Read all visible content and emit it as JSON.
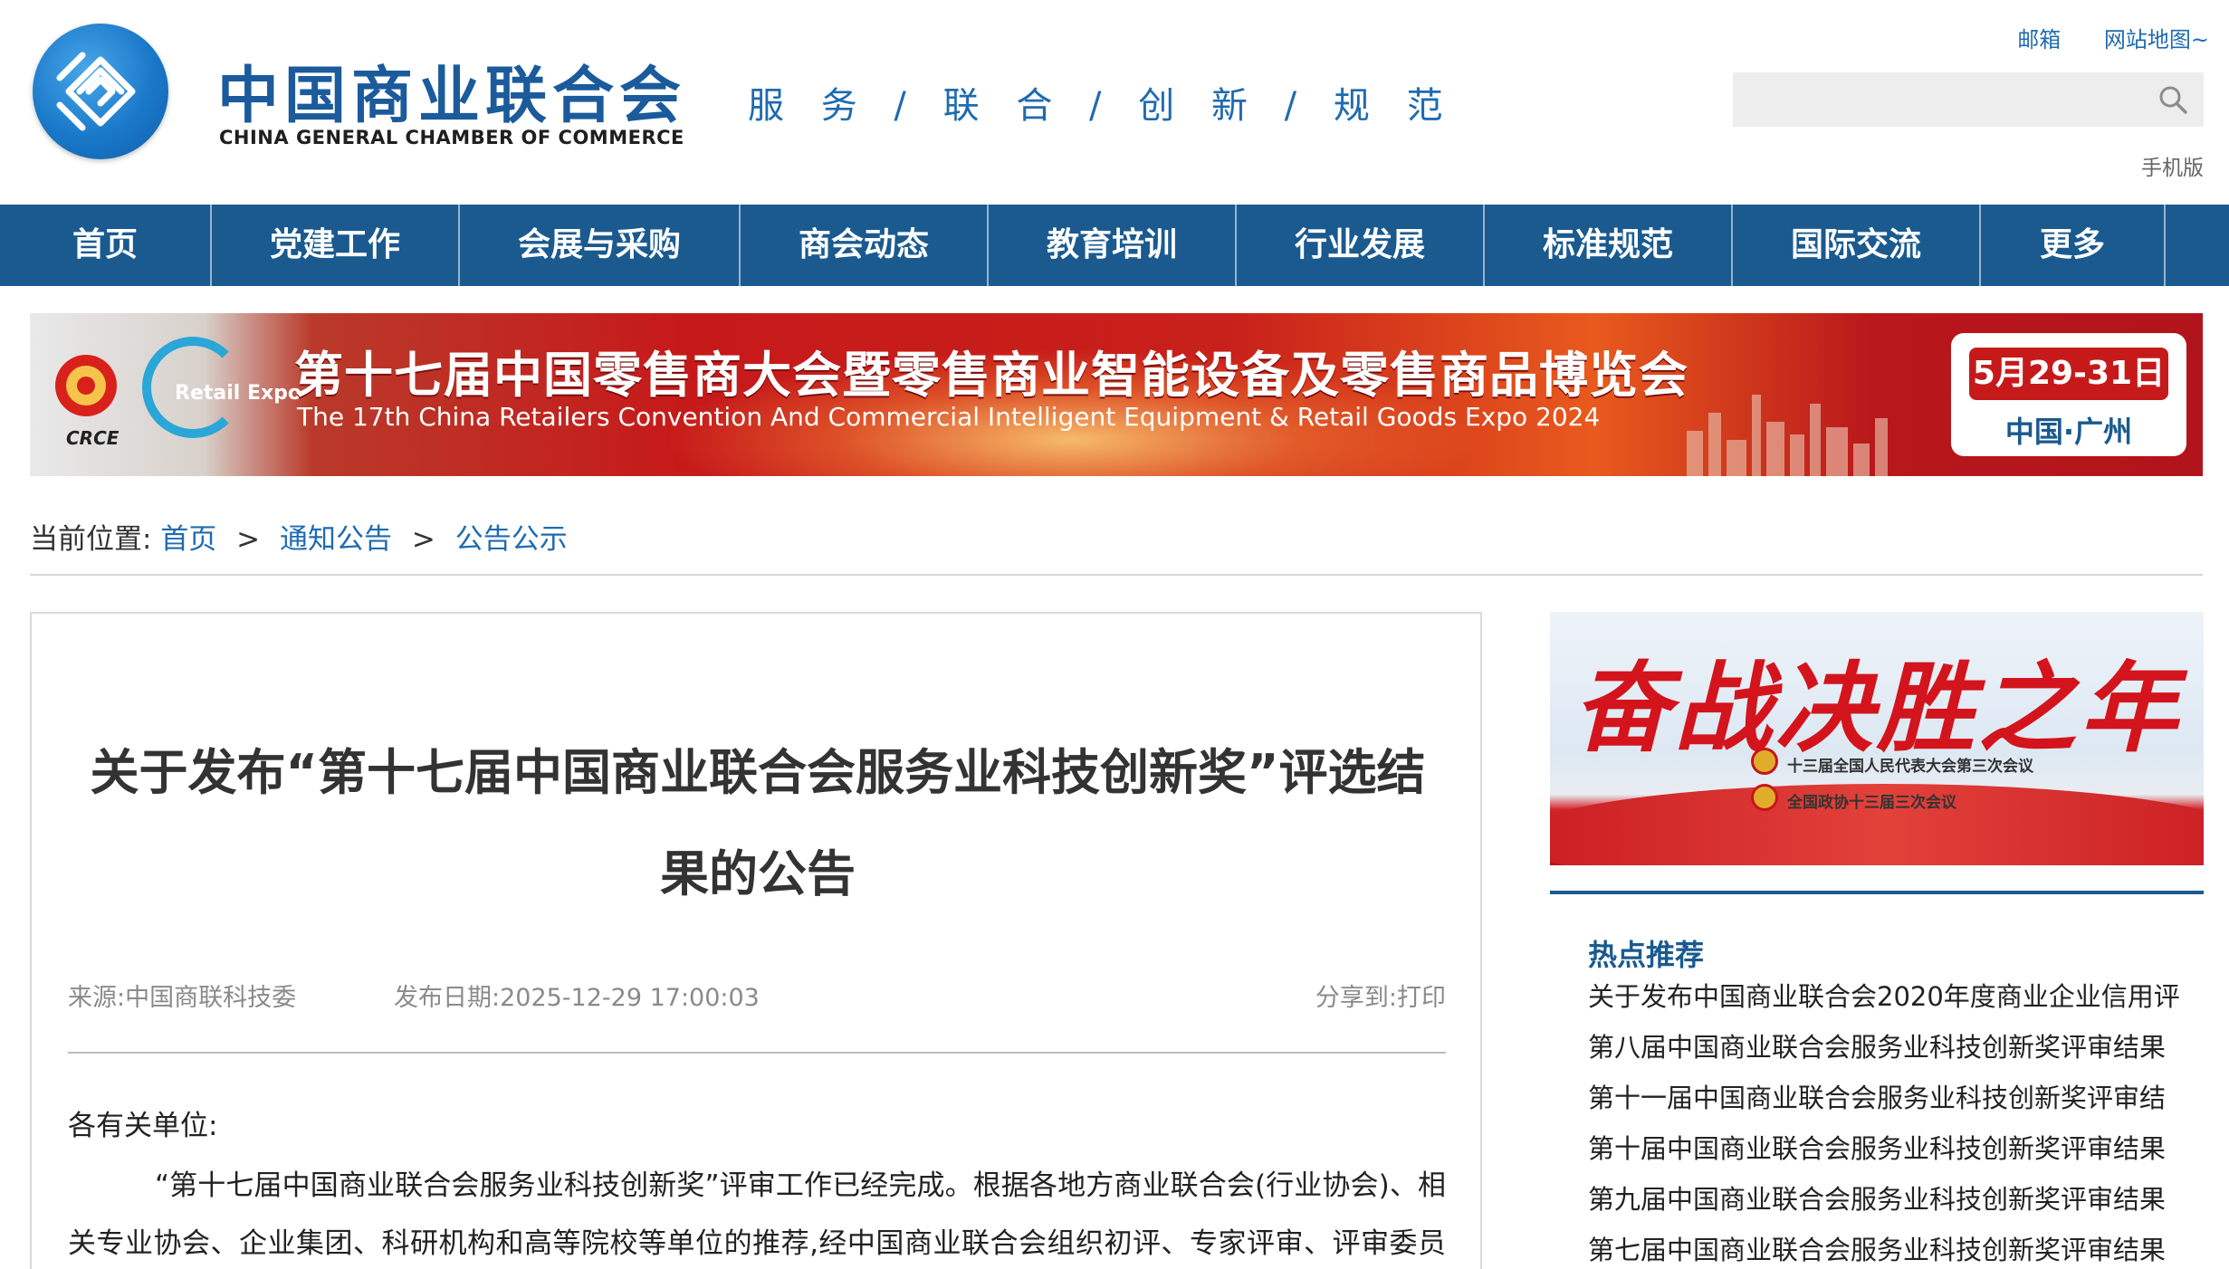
{
  "header": {
    "org_name_cn": "中国商业联合会",
    "org_name_en": "CHINA GENERAL CHAMBER OF COMMERCE",
    "slogan": "服 务 / 联 合 / 创 新 / 规 范",
    "top_links": [
      "邮箱",
      "网站地图~"
    ],
    "search": {
      "placeholder": ""
    },
    "mobile_link": "手机版"
  },
  "nav": {
    "items": [
      "首页",
      "党建工作",
      "会展与采购",
      "商会动态",
      "教育培训",
      "行业发展",
      "标准规范",
      "国际交流",
      "更多"
    ]
  },
  "banner": {
    "crce_label": "CRCE",
    "retail_expo": "Retail Expo",
    "title": "第十七届中国零售商大会暨零售商业智能设备及零售商品博览会",
    "subtitle": "The 17th China Retailers Convention And Commercial Intelligent Equipment & Retail Goods Expo 2024",
    "date": "5月29-31日",
    "place": "中国·广州"
  },
  "breadcrumb": {
    "prefix": "当前位置:",
    "items": [
      "首页",
      "通知公告",
      "公告公示"
    ],
    "separator": ">"
  },
  "article": {
    "title": "关于发布“第十七届中国商业联合会服务业科技创新奖”评选结果的公告",
    "source": "来源:中国商联科技委",
    "date": "发布日期:2025-12-29 17:00:03",
    "share_label": "分享到:",
    "print_label": "打印",
    "salutation": "各有关单位:",
    "body": "“第十七届中国商业联合会服务业科技创新奖”评审工作已经完成。根据各地方商业联合会(行业协会)、相关专业协会、企业集团、科研机构和高等院校等单位的推荐,经中国商业联合会组织初评、专家评审、评审委员会"
  },
  "sidebar": {
    "banner": {
      "title": "奋战决胜之年",
      "line1": "十三届全国人民代表大会第三次会议",
      "line2": "全国政协十三届三次会议"
    },
    "hot_title": "热点推荐",
    "hot_items": [
      "关于发布中国商业联合会2020年度商业企业信用评",
      "第八届中国商业联合会服务业科技创新奖评审结果",
      "第十一届中国商业联合会服务业科技创新奖评审结",
      "第十届中国商业联合会服务业科技创新奖评审结果",
      "第九届中国商业联合会服务业科技创新奖评审结果",
      "第七届中国商业联合会服务业科技创新奖评审结果"
    ]
  },
  "colors": {
    "brand_blue": "#1a5a8f",
    "link_blue": "#1f6bb0",
    "banner_red": "#c61a1a"
  }
}
